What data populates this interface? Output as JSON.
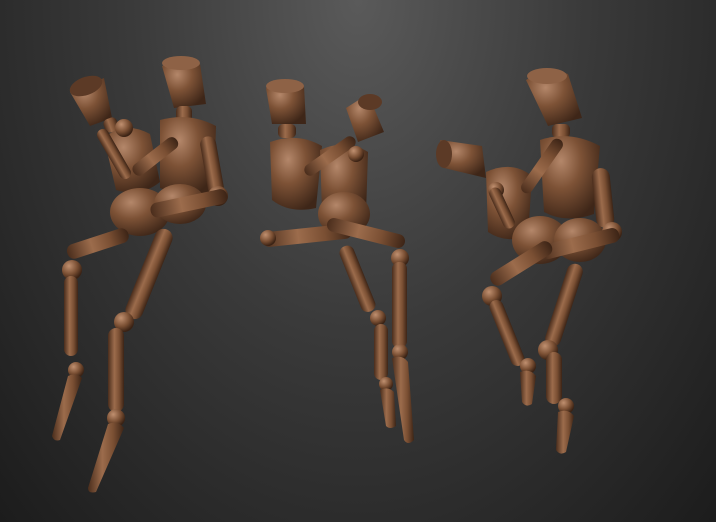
{
  "scene": {
    "background_top": "#5a5a5a",
    "background_bottom": "#1c1c1c",
    "material_base": "#7a4f33",
    "material_highlight": "#b08060",
    "material_shadow": "#3c2416",
    "figures": [
      {
        "name": "mannequin-pair-left"
      },
      {
        "name": "mannequin-pair-center"
      },
      {
        "name": "mannequin-pair-right"
      }
    ]
  }
}
